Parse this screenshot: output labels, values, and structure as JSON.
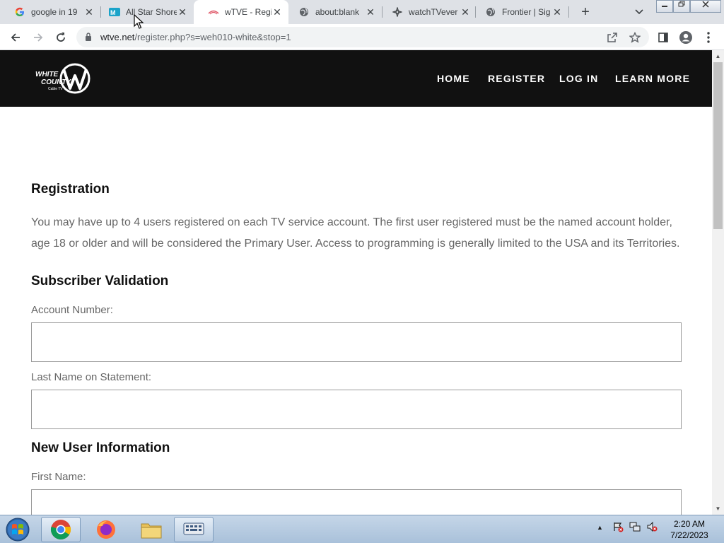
{
  "browser": {
    "tabs": [
      {
        "title": "google in 19",
        "icon": "google-icon"
      },
      {
        "title": "All Star Shore",
        "icon": "allstar-icon"
      },
      {
        "title": "wTVE - Regis",
        "icon": "wtve-icon",
        "active": true
      },
      {
        "title": "about:blank",
        "icon": "globe-icon"
      },
      {
        "title": "watchTVever",
        "icon": "watchtv-icon"
      },
      {
        "title": "Frontier | Sig",
        "icon": "globe-icon"
      }
    ],
    "new_tab_label": "+",
    "url_host": "wtve.net",
    "url_path": "/register.php?s=weh010-white&stop=1"
  },
  "site": {
    "logo_text": "WHITE COUNTY",
    "logo_sub": "Cable TV",
    "nav": [
      "HOME",
      "REGISTER",
      "LOG IN",
      "LEARN MORE"
    ]
  },
  "page": {
    "title": "Registration",
    "intro": "You may have up to 4 users registered on each TV service account. The first user registered must be the named account holder, age 18 or older and will be considered the Primary User. Access to programming is generally limited to the USA and its Territories.",
    "section1": "Subscriber Validation",
    "account_label": "Account Number:",
    "account_value": "",
    "lastname_label": "Last Name on Statement:",
    "lastname_value": "",
    "section2": "New User Information",
    "firstname_label": "First Name:",
    "firstname_value": ""
  },
  "taskbar": {
    "time": "2:20 AM",
    "date": "7/22/2023"
  }
}
